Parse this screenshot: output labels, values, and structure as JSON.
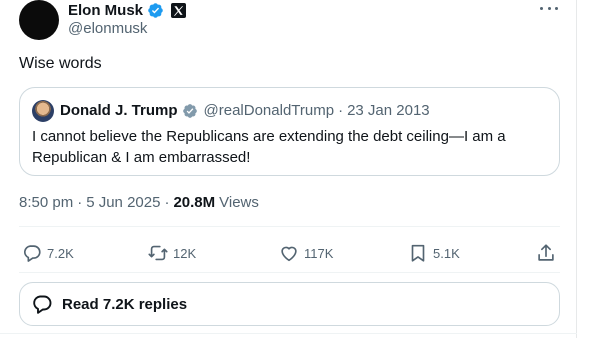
{
  "author": {
    "display_name": "Elon Musk",
    "handle": "@elonmusk",
    "verified": true,
    "affiliation_icon": "x-logo-icon"
  },
  "tweet": {
    "text": "Wise words"
  },
  "quoted_tweet": {
    "display_name": "Donald J. Trump",
    "handle": "@realDonaldTrump",
    "separator": "·",
    "date": "23 Jan 2013",
    "verified_color": "#829aab",
    "text": "I cannot believe the Republicans are extending the debt ceiling—I am a Republican & I am embarrassed!"
  },
  "meta": {
    "time": "8:50 pm",
    "separator_1": "·",
    "date": "5 Jun 2025",
    "separator_2": "·",
    "views_count": "20.8M",
    "views_label": "Views"
  },
  "actions": {
    "reply_count": "7.2K",
    "repost_count": "12K",
    "like_count": "117K",
    "bookmark_count": "5.1K"
  },
  "read_replies": {
    "label": "Read 7.2K replies"
  },
  "colors": {
    "verified": "#1d9bf0",
    "text_primary": "#0f1419",
    "text_secondary": "#536471",
    "border": "#cfd9de"
  }
}
